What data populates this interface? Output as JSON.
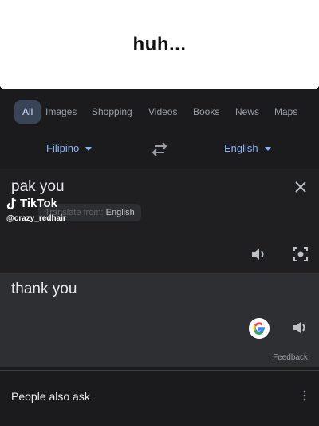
{
  "caption": {
    "text": "huh..."
  },
  "tabs": [
    {
      "label": "All",
      "active": true
    },
    {
      "label": "Images"
    },
    {
      "label": "Shopping"
    },
    {
      "label": "Videos"
    },
    {
      "label": "Books"
    },
    {
      "label": "News"
    },
    {
      "label": "Maps"
    }
  ],
  "translator": {
    "source_lang": "Filipino",
    "target_lang": "English",
    "source_text": "pak you",
    "detected_prefix": "Translate from:",
    "detected_lang": "English",
    "target_text": "thank you",
    "feedback_label": "Feedback"
  },
  "watermark": {
    "brand": "TikTok",
    "handle": "@crazy_redhair"
  },
  "people_also_ask": {
    "label": "People also ask"
  },
  "colors": {
    "accent": "#8ab4f8",
    "active_tab_bg": "#394457",
    "surface": "#1b1b1d"
  },
  "icons": [
    "swap-icon",
    "close-icon",
    "speaker-icon",
    "camera-lens-icon",
    "google-g-icon",
    "more-vert-icon",
    "caret-down-icon"
  ]
}
